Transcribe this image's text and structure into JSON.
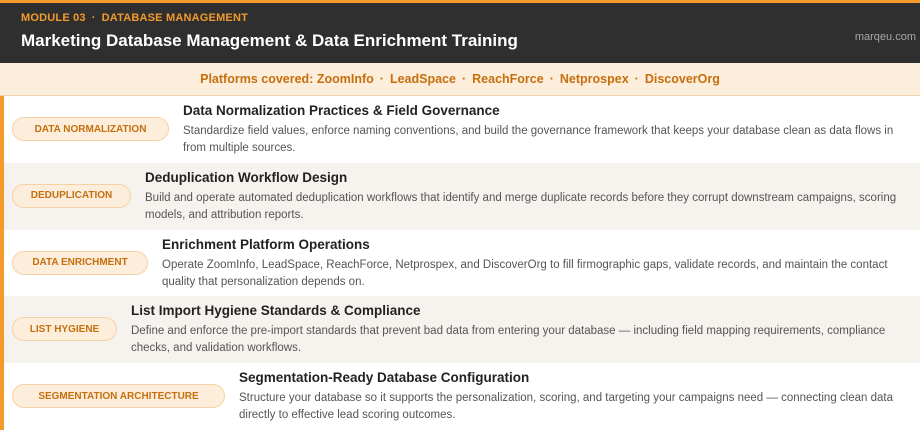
{
  "header": {
    "module_number": "MODULE 03",
    "module_name": "DATABASE MANAGEMENT",
    "title": "Marketing Database Management & Data Enrichment Training",
    "site": "marqeu.com"
  },
  "platforms": {
    "label": "Platforms covered:",
    "items": [
      "ZoomInfo",
      "LeadSpace",
      "ReachForce",
      "Netprospex",
      "DiscoverOrg"
    ]
  },
  "topics": [
    {
      "tag": "DATA NORMALIZATION",
      "title": "Data Normalization Practices & Field Governance",
      "description": "Standardize field values, enforce naming conventions, and build the governance framework that keeps your database clean as data flows in from multiple sources."
    },
    {
      "tag": "DEDUPLICATION",
      "title": "Deduplication Workflow Design",
      "description": "Build and operate automated deduplication workflows that identify and merge duplicate records before they corrupt downstream campaigns, scoring models, and attribution reports."
    },
    {
      "tag": "DATA ENRICHMENT",
      "title": "Enrichment Platform Operations",
      "description": "Operate ZoomInfo, LeadSpace, ReachForce, Netprospex, and DiscoverOrg to fill firmographic gaps, validate records, and maintain the contact quality that personalization depends on."
    },
    {
      "tag": "LIST HYGIENE",
      "title": "List Import Hygiene Standards & Compliance",
      "description": "Define and enforce the pre-import standards that prevent bad data from entering your database — including field mapping requirements, compliance checks, and validation workflows."
    },
    {
      "tag": "SEGMENTATION ARCHITECTURE",
      "title": "Segmentation-Ready Database Configuration",
      "description": "Structure your database so it supports the personalization, scoring, and targeting your campaigns need — connecting clean data directly to effective lead scoring outcomes."
    }
  ]
}
